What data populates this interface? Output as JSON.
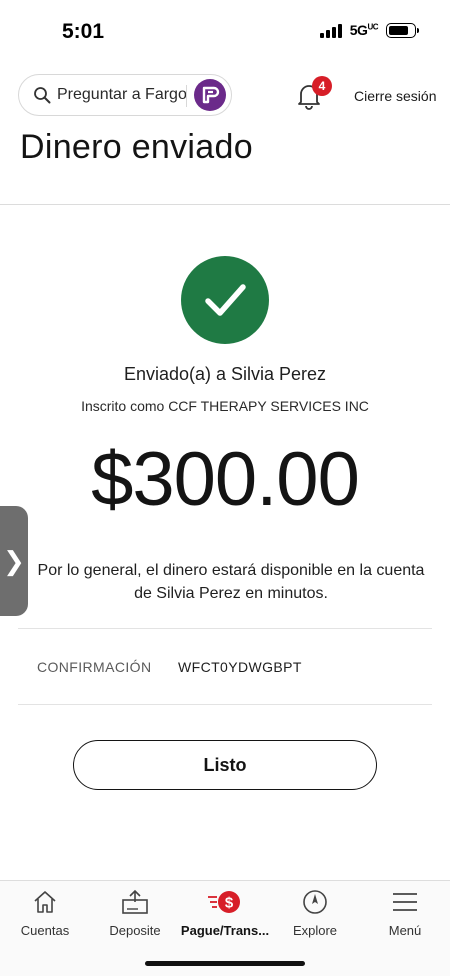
{
  "status_bar": {
    "time": "5:01",
    "network": "5G",
    "network_sup": "UC",
    "signal_bars": 4,
    "battery_level": 0.8
  },
  "header": {
    "search_placeholder": "Preguntar a Fargo",
    "notification_count": "4",
    "signout_label": "Cierre sesión"
  },
  "page": {
    "title": "Dinero enviado",
    "sent_to": "Enviado(a) a Silvia Perez",
    "enrolled_as": "Inscrito como CCF THERAPY SERVICES INC",
    "amount": "$300.00",
    "availability_note_line1": "Por lo general, el dinero estará disponible en la cuenta",
    "availability_note_line2": "de Silvia Perez en minutos.",
    "confirmation_label": "CONFIRMACIÓN",
    "confirmation_value": "WFCT0YDWGBPT",
    "done_label": "Listo",
    "side_handle_glyph": "❯"
  },
  "bottom_nav": {
    "items": [
      {
        "label": "Cuentas",
        "icon": "home-icon"
      },
      {
        "label": "Deposite",
        "icon": "deposit-icon"
      },
      {
        "label": "Pague/Trans...",
        "icon": "pay-transfer-icon",
        "active": true
      },
      {
        "label": "Explore",
        "icon": "compass-icon"
      },
      {
        "label": "Menú",
        "icon": "hamburger-menu-icon"
      }
    ]
  },
  "colors": {
    "brand_purple": "#6b2a8a",
    "success_green": "#1f7a44",
    "alert_red": "#d71e28"
  }
}
